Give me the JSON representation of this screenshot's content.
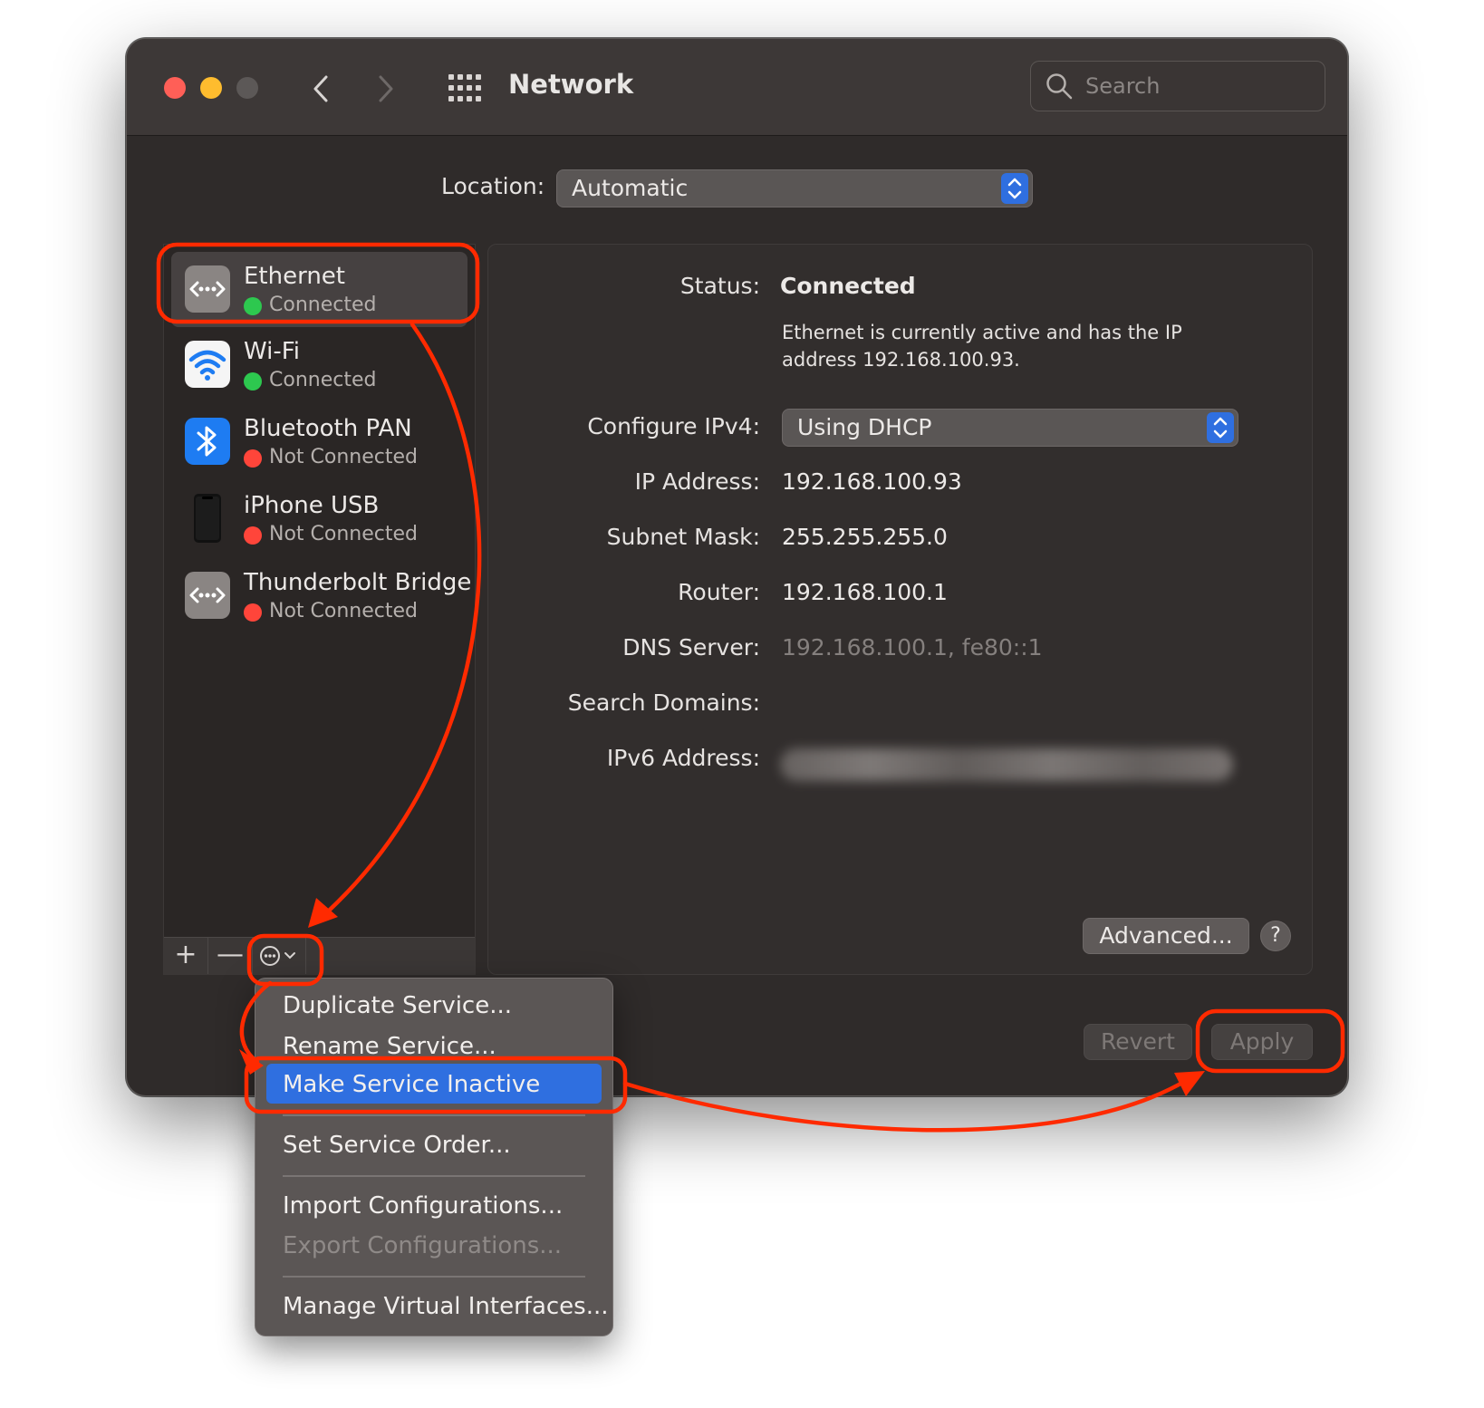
{
  "window": {
    "title": "Network",
    "search_placeholder": "Search"
  },
  "location": {
    "label": "Location:",
    "value": "Automatic"
  },
  "services": [
    {
      "name": "Ethernet",
      "status": "Connected"
    },
    {
      "name": "Wi-Fi",
      "status": "Connected"
    },
    {
      "name": "Bluetooth PAN",
      "status": "Not Connected"
    },
    {
      "name": "iPhone USB",
      "status": "Not Connected"
    },
    {
      "name": "Thunderbolt Bridge",
      "status": "Not Connected"
    }
  ],
  "sidebar_footer": {
    "add": "+",
    "remove": "—"
  },
  "details": {
    "status_label": "Status:",
    "status_value": "Connected",
    "status_desc": "Ethernet is currently active and has the IP address 192.168.100.93.",
    "configure_label": "Configure IPv4:",
    "configure_value": "Using DHCP",
    "ip_label": "IP Address:",
    "ip_value": "192.168.100.93",
    "subnet_label": "Subnet Mask:",
    "subnet_value": "255.255.255.0",
    "router_label": "Router:",
    "router_value": "192.168.100.1",
    "dns_label": "DNS Server:",
    "dns_value": "192.168.100.1, fe80::1",
    "search_domains_label": "Search Domains:",
    "ipv6_label": "IPv6 Address:",
    "advanced_label": "Advanced...",
    "help_label": "?"
  },
  "footer": {
    "revert": "Revert",
    "apply": "Apply"
  },
  "menu": {
    "items": [
      "Duplicate Service...",
      "Rename Service...",
      "Make Service Inactive",
      "Set Service Order...",
      "Import Configurations...",
      "Export Configurations...",
      "Manage Virtual Interfaces..."
    ]
  },
  "colors": {
    "accent": "#2f6fe0",
    "annotation": "#ff2a00",
    "connected": "#2dc84f",
    "not_connected": "#ff453a"
  }
}
